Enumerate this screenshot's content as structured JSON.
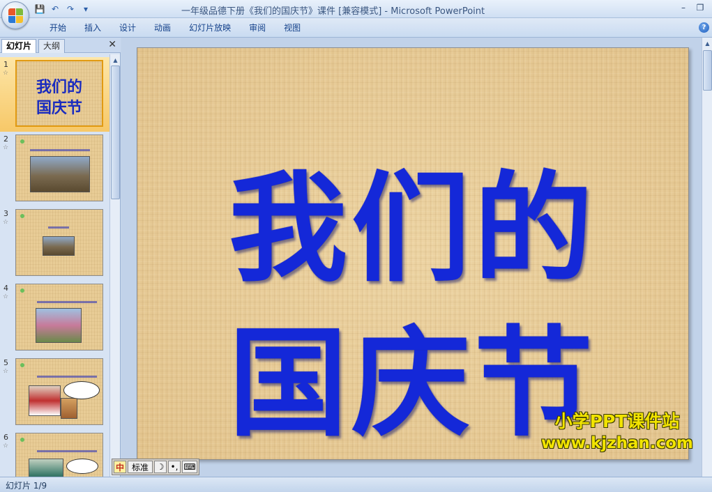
{
  "titlebar": {
    "title": "一年级品德下册《我们的国庆节》课件 [兼容模式] - Microsoft PowerPoint",
    "qat": {
      "save": "💾",
      "undo": "↶",
      "redo": "↷",
      "more": "▾"
    },
    "controls": {
      "minimize": "–",
      "restore": "❐"
    }
  },
  "ribbon": {
    "tabs": [
      "开始",
      "插入",
      "设计",
      "动画",
      "幻灯片放映",
      "审阅",
      "视图"
    ],
    "help": "?"
  },
  "left_pane": {
    "tab_slides": "幻灯片",
    "tab_outline": "大纲",
    "close": "✕",
    "thumbnails": [
      {
        "number": "1",
        "title": "我们的\n国庆节"
      },
      {
        "number": "2"
      },
      {
        "number": "3"
      },
      {
        "number": "4"
      },
      {
        "number": "5"
      },
      {
        "number": "6"
      }
    ],
    "anim_marker": "☆"
  },
  "slide": {
    "title_line1": "我们的",
    "title_line2": "国庆节"
  },
  "watermark": {
    "line1": "小学PPT课件站",
    "line2": "www.kjzhan.com"
  },
  "ime": {
    "logo": "中",
    "mode": "标准",
    "moon": "☽",
    "punct": "•,",
    "keyboard": "⌨"
  },
  "status": {
    "slide_counter": "幻灯片 1/9"
  },
  "colors": {
    "title_blue": "#1428d8",
    "watermark_yellow": "#f2e400",
    "selected_thumb": "#f7c868"
  }
}
